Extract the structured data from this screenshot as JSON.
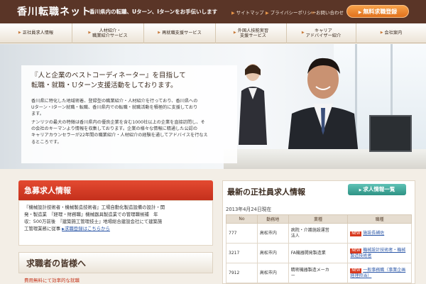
{
  "header": {
    "logo": "香川転職ネット",
    "tagline": "香川県内の転職、Uターン、Iターンをお手伝いします",
    "links": [
      "サイトマップ",
      "プライバシーポリシー",
      "お問い合わせ"
    ],
    "register_button": "無料求職登録"
  },
  "nav": {
    "items": [
      [
        "正社員求人情報"
      ],
      [
        "人材紹介・",
        "職業紹介サービス"
      ],
      [
        "再就職支援サービス"
      ],
      [
        "外国人技能実習",
        "支援サービス"
      ],
      [
        "キャリア",
        "アドバイザー紹介"
      ],
      [
        "会社案内"
      ]
    ]
  },
  "hero": {
    "title_line1": "『人と企業のベストコーディネーター』を目指して",
    "title_line2": "転職・就職・Uターン支援活動をしております。",
    "para1": [
      "香川県に特化した地域密着、登録型の職業紹介・人材紹介を行っており、香川県への",
      "Uターン・Iターン就職・転職、香川県内での転職・就職活動を積極的に支援しており",
      "ます。"
    ],
    "para2": [
      "ナンリツの最大の特徴は香川県内の優良企業を含む1000社以上の企業を直接訪問し、そ",
      "の会社のキーマンより情報を収集しております。企業の様々な情報に精通した公認の",
      "キャリアカウンセラーが22年間の職業紹介・人材紹介の経験を通してアドバイスを行なえ",
      "るところです。"
    ]
  },
  "recruit": {
    "heading": "急募求人情報",
    "line1": "『機械設計技術者・機械製造技術者』工場自動化製造設備の設計・開",
    "line2": "発・製造業　『経理・財務職』機械器具製造業での管理職候補　年",
    "line3": "収：500万前後　『建築施工管理技士』地場総合建設会社にて建築施",
    "line4": "工管理業務に従事",
    "detail_link": "求職登録はこちらから"
  },
  "seekers": {
    "heading": "求職者の皆様へ",
    "sub": "費用無料にて効率的な就職"
  },
  "latest": {
    "title": "最新の正社員求人情報",
    "list_button": "求人情報一覧",
    "date_note": "2013年4月24日現在",
    "columns": [
      "No",
      "勤務地",
      "業種",
      "職種"
    ],
    "rows": [
      {
        "no": "777",
        "place": "高松市内",
        "industry": [
          "病院・介護施設運営",
          "法人"
        ],
        "job": [
          "施設長補佐"
        ]
      },
      {
        "no": "3217",
        "place": "高松市内",
        "industry": [
          "FA機器開発製造業"
        ],
        "job": [
          "機械設計技術者・機械",
          "製造技術者"
        ]
      },
      {
        "no": "7912",
        "place": "高松市内",
        "industry": [
          "精密機器製造メーカ",
          "ー"
        ],
        "job": [
          "一般事務職（事業企画",
          "経理担当）"
        ]
      }
    ],
    "new_label": "NEW"
  }
}
